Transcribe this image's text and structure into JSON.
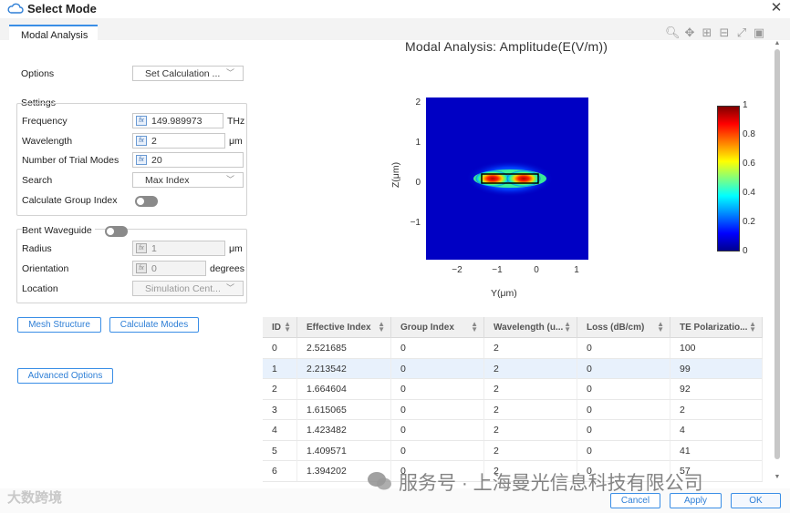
{
  "window": {
    "title": "Select Mode",
    "close_icon": "close-icon"
  },
  "tabs": [
    {
      "label": "Modal Analysis"
    }
  ],
  "options": {
    "label": "Options",
    "value": "Set Calculation ..."
  },
  "settings": {
    "group_label": "Settings",
    "frequency": {
      "label": "Frequency",
      "value": "149.989973",
      "unit": "THz"
    },
    "wavelength": {
      "label": "Wavelength",
      "value": "2",
      "unit": "μm"
    },
    "trial_modes": {
      "label": "Number of Trial Modes",
      "value": "20"
    },
    "search": {
      "label": "Search",
      "value": "Max Index"
    },
    "group_index": {
      "label": "Calculate Group Index",
      "enabled": false
    }
  },
  "bent": {
    "label": "Bent Waveguide",
    "enabled": false,
    "radius": {
      "label": "Radius",
      "value": "1",
      "unit": "μm"
    },
    "orientation": {
      "label": "Orientation",
      "value": "0",
      "unit": "degrees"
    },
    "location": {
      "label": "Location",
      "value": "Simulation Cent..."
    }
  },
  "buttons": {
    "mesh": "Mesh Structure",
    "calc_modes": "Calculate Modes",
    "advanced": "Advanced Options",
    "cancel": "Cancel",
    "apply": "Apply",
    "ok": "OK"
  },
  "plot": {
    "title": "Modal Analysis: Amplitude(E(V/m))",
    "xlabel": "Y(μm)",
    "ylabel": "Z(μm)",
    "xticks": [
      "−2",
      "−1",
      "0",
      "1"
    ],
    "yticks": [
      "2",
      "1",
      "0",
      "−1"
    ],
    "colorbar_ticks": [
      "1",
      "0.8",
      "0.6",
      "0.4",
      "0.2",
      "0"
    ],
    "toolbar": [
      "zoom-icon",
      "pan-icon",
      "zoom-in-icon",
      "zoom-out-icon",
      "autoscale-icon",
      "camera-icon"
    ]
  },
  "table": {
    "columns": [
      "ID",
      "Effective Index",
      "Group Index",
      "Wavelength (u...",
      "Loss (dB/cm)",
      "TE Polarizatio..."
    ],
    "rows": [
      [
        "0",
        "2.521685",
        "0",
        "2",
        "0",
        "100"
      ],
      [
        "1",
        "2.213542",
        "0",
        "2",
        "0",
        "99"
      ],
      [
        "2",
        "1.664604",
        "0",
        "2",
        "0",
        "92"
      ],
      [
        "3",
        "1.615065",
        "0",
        "2",
        "0",
        "2"
      ],
      [
        "4",
        "1.423482",
        "0",
        "2",
        "0",
        "4"
      ],
      [
        "5",
        "1.409571",
        "0",
        "2",
        "0",
        "41"
      ],
      [
        "6",
        "1.394202",
        "0",
        "2",
        "0",
        "57"
      ]
    ],
    "selected_row": 1
  },
  "watermarks": {
    "left": "大数跨境",
    "right": "服务号 · 上海曼光信息科技有限公司"
  },
  "colors": {
    "accent": "#3a8ee6",
    "field_bg": "#0000c4"
  }
}
